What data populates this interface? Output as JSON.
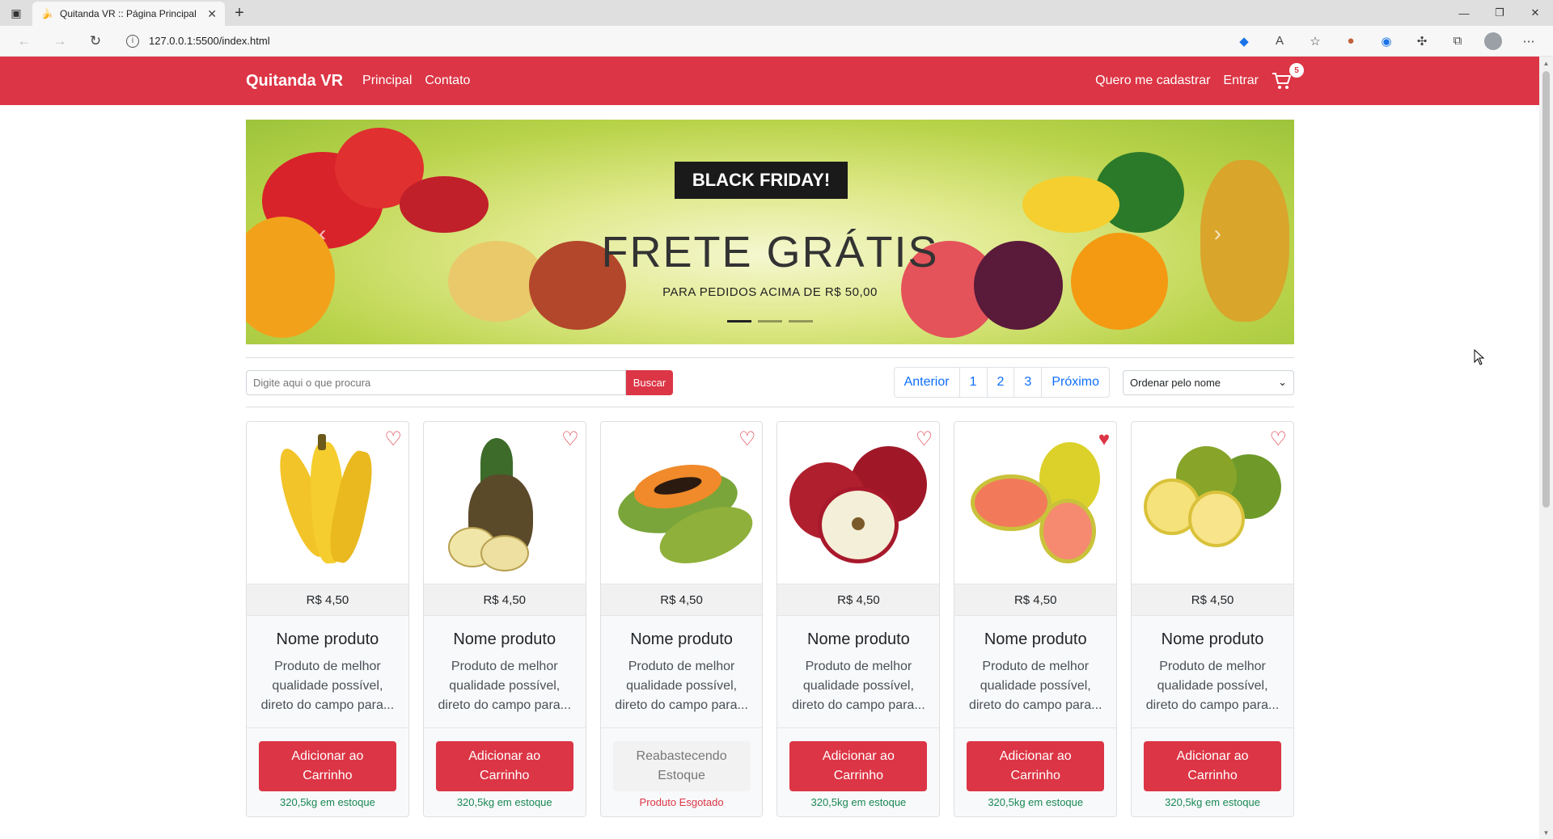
{
  "browser": {
    "tab_title": "Quitanda VR :: Página Principal",
    "url": "127.0.0.1:5500/index.html"
  },
  "navbar": {
    "brand": "Quitanda VR",
    "links": [
      "Principal",
      "Contato"
    ],
    "register": "Quero me cadastrar",
    "login": "Entrar",
    "cart_count": "5"
  },
  "carousel": {
    "badge": "BLACK FRIDAY!",
    "headline": "FRETE GRÁTIS",
    "subline": "PARA PEDIDOS ACIMA DE R$ 50,00",
    "slides": 3,
    "active_slide": 1
  },
  "controls": {
    "search_placeholder": "Digite aqui o que procura",
    "search_button": "Buscar",
    "pagination": [
      "Anterior",
      "1",
      "2",
      "3",
      "Próximo"
    ],
    "sort_selected": "Ordenar pelo nome"
  },
  "products": [
    {
      "fruit": "banana",
      "favorite": false,
      "price": "R$ 4,50",
      "name": "Nome produto",
      "desc": "Produto de melhor qualidade possível, direto do campo para...",
      "button": "Adicionar ao Carrinho",
      "stock": "320,5kg em estoque",
      "in_stock": true
    },
    {
      "fruit": "pineapple",
      "favorite": false,
      "price": "R$ 4,50",
      "name": "Nome produto",
      "desc": "Produto de melhor qualidade possível, direto do campo para...",
      "button": "Adicionar ao Carrinho",
      "stock": "320,5kg em estoque",
      "in_stock": true
    },
    {
      "fruit": "papaya",
      "favorite": false,
      "price": "R$ 4,50",
      "name": "Nome produto",
      "desc": "Produto de melhor qualidade possível, direto do campo para...",
      "button": "Reabastecendo Estoque",
      "stock": "Produto Esgotado",
      "in_stock": false
    },
    {
      "fruit": "apple",
      "favorite": false,
      "price": "R$ 4,50",
      "name": "Nome produto",
      "desc": "Produto de melhor qualidade possível, direto do campo para...",
      "button": "Adicionar ao Carrinho",
      "stock": "320,5kg em estoque",
      "in_stock": true
    },
    {
      "fruit": "guava",
      "favorite": true,
      "price": "R$ 4,50",
      "name": "Nome produto",
      "desc": "Produto de melhor qualidade possível, direto do campo para...",
      "button": "Adicionar ao Carrinho",
      "stock": "320,5kg em estoque",
      "in_stock": true
    },
    {
      "fruit": "orange",
      "favorite": false,
      "price": "R$ 4,50",
      "name": "Nome produto",
      "desc": "Produto de melhor qualidade possível, direto do campo para...",
      "button": "Adicionar ao Carrinho",
      "stock": "320,5kg em estoque",
      "in_stock": true
    }
  ],
  "colors": {
    "brand": "#dc3545",
    "stock_ok": "#198754",
    "link": "#0d6efd"
  }
}
